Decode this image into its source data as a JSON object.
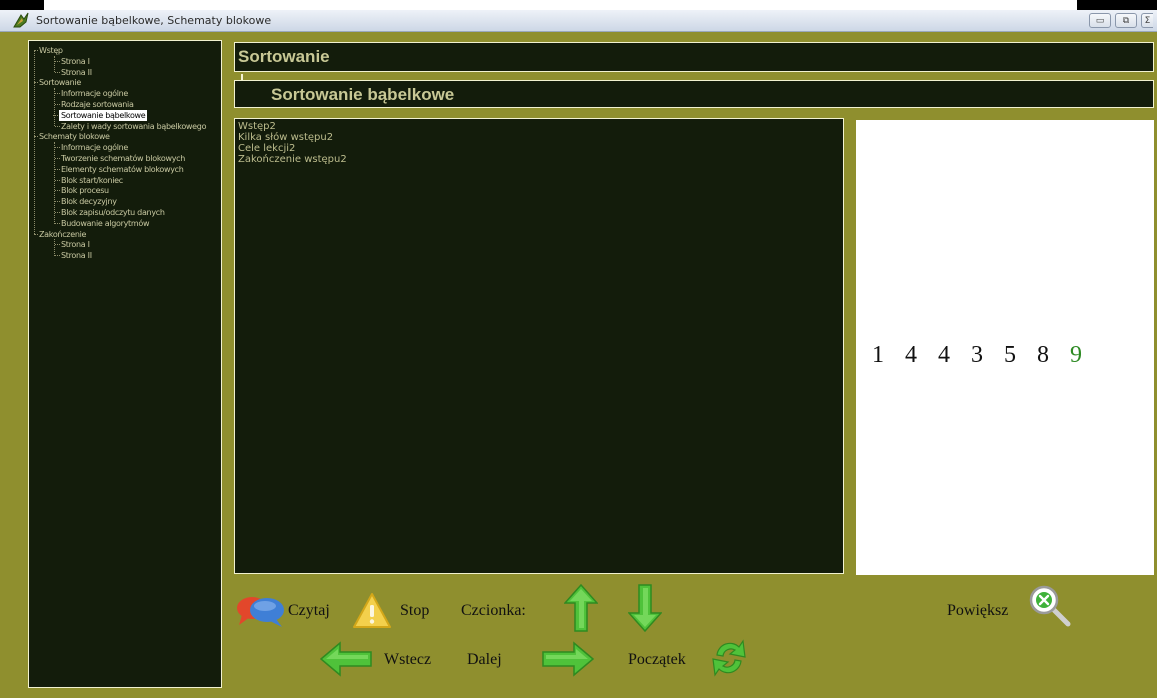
{
  "window": {
    "title": "Sortowanie bąbelkowe, Schematy blokowe",
    "controls": [
      "▭",
      "⧉",
      "Σ"
    ]
  },
  "sidebar": {
    "items": [
      {
        "label": "Wstęp",
        "level": 0
      },
      {
        "label": "Strona I",
        "level": 1
      },
      {
        "label": "Strona II",
        "level": 1
      },
      {
        "label": "Sortowanie",
        "level": 0
      },
      {
        "label": "Informacje ogólne",
        "level": 1
      },
      {
        "label": "Rodzaje sortowania",
        "level": 1
      },
      {
        "label": "Sortowanie bąbelkowe",
        "level": 1,
        "selected": true
      },
      {
        "label": "Zalety i wady sortowania bąbelkowego",
        "level": 1
      },
      {
        "label": "Schematy blokowe",
        "level": 0
      },
      {
        "label": "Informacje ogólne",
        "level": 1
      },
      {
        "label": "Tworzenie schematów blokowych",
        "level": 1
      },
      {
        "label": "Elementy schematów blokowych",
        "level": 1
      },
      {
        "label": "Blok start/koniec",
        "level": 1
      },
      {
        "label": "Blok procesu",
        "level": 1
      },
      {
        "label": "Blok decyzyjny",
        "level": 1
      },
      {
        "label": "Blok zapisu/odczytu danych",
        "level": 1
      },
      {
        "label": "Budowanie algorytmów",
        "level": 1
      },
      {
        "label": "Zakończenie",
        "level": 0
      },
      {
        "label": "Strona I",
        "level": 1
      },
      {
        "label": "Strona II",
        "level": 1
      }
    ]
  },
  "header": {
    "section": "Sortowanie",
    "subsection": "Sortowanie bąbelkowe"
  },
  "content": {
    "lines": [
      "Wstęp2",
      "Kilka słów wstępu2",
      "Cele lekcji2",
      "Zakończenie wstępu2"
    ]
  },
  "animation": {
    "numbers": [
      {
        "value": "1",
        "color": "#111111"
      },
      {
        "value": "4",
        "color": "#111111"
      },
      {
        "value": "4",
        "color": "#111111"
      },
      {
        "value": "3",
        "color": "#111111"
      },
      {
        "value": "5",
        "color": "#111111"
      },
      {
        "value": "8",
        "color": "#111111"
      },
      {
        "value": "9",
        "color": "#2d8a23"
      }
    ]
  },
  "controls": {
    "read_label": "Czytaj",
    "stop_label": "Stop",
    "font_label": "Czcionka:",
    "zoom_label": "Powiększ",
    "back_label": "Wstecz",
    "next_label": "Dalej",
    "start_label": "Początek"
  },
  "colors": {
    "frame": "#8f8f2e",
    "panel": "#131c0b",
    "panel_text": "#c8c895",
    "arrow_green": "#4fc23a"
  }
}
